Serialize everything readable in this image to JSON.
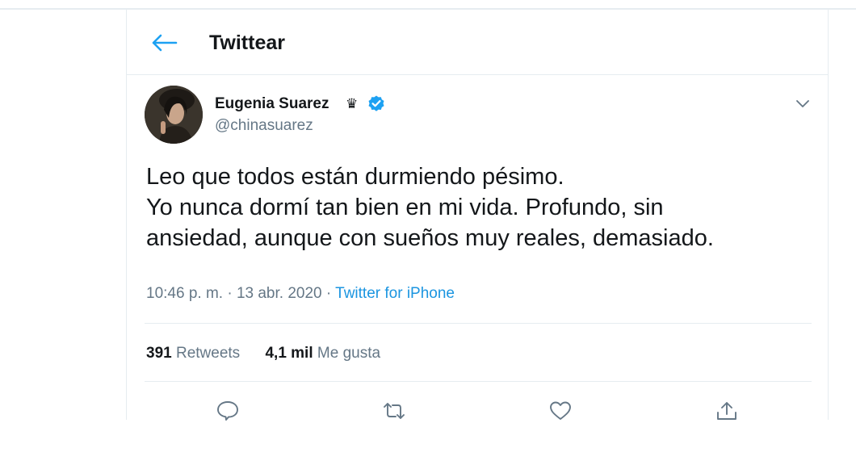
{
  "header": {
    "title": "Twittear",
    "back_icon": "arrow-left-icon"
  },
  "tweet": {
    "display_name": "Eugenia Suarez",
    "name_emoji": "♛",
    "verified": true,
    "handle": "@chinasuarez",
    "text_lines": [
      "Leo que todos están durmiendo pésimo.",
      "Yo nunca dormí tan bien en mi vida. Profundo, sin",
      "ansiedad, aunque con sueños muy reales, demasiado."
    ],
    "time": "10:46 p. m.",
    "separator": "·",
    "date": "13 abr. 2020",
    "source": "Twitter for iPhone",
    "retweets_count": "391",
    "retweets_label": "Retweets",
    "likes_count": "4,1 mil",
    "likes_label": "Me gusta"
  },
  "actions": [
    "reply-icon",
    "retweet-icon",
    "like-icon",
    "share-icon"
  ],
  "colors": {
    "accent": "#1da1f2",
    "link": "#1b95e0",
    "muted": "#657786",
    "border": "#e6ecf0",
    "text": "#14171a"
  }
}
